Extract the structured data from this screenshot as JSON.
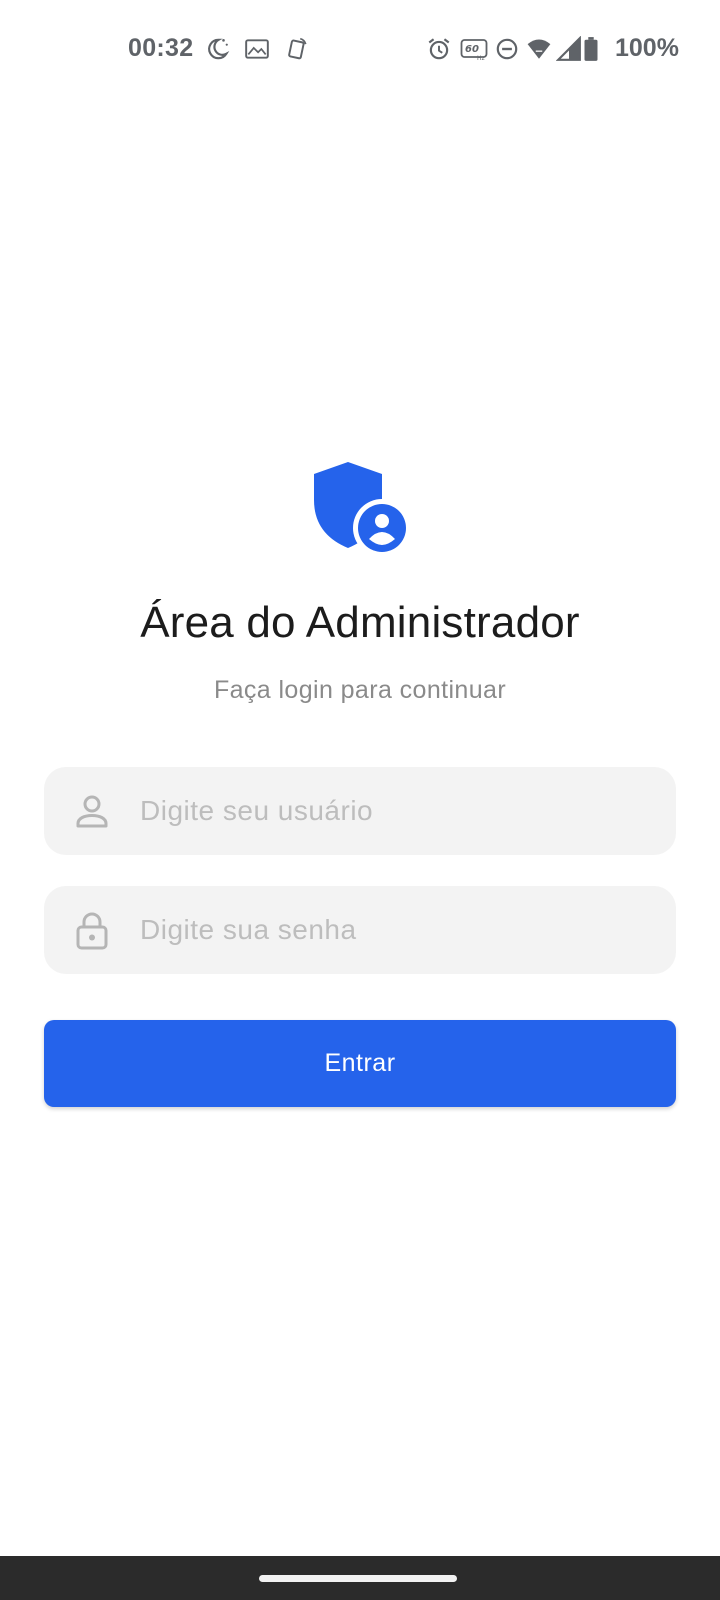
{
  "status_bar": {
    "time": "00:32",
    "battery": "100%",
    "refresh_rate": "60",
    "refresh_unit": "Hz",
    "icons": [
      "moon-icon",
      "image-icon",
      "rotate-icon",
      "alarm-icon",
      "refresh-rate-icon",
      "do-not-disturb-icon",
      "wifi-icon",
      "signal-icon",
      "battery-icon"
    ]
  },
  "login": {
    "logo_icon": "shield-user-icon",
    "title": "Área do Administrador",
    "subtitle": "Faça login para continuar",
    "username": {
      "icon": "user-icon",
      "placeholder": "Digite seu usuário",
      "value": ""
    },
    "password": {
      "icon": "lock-icon",
      "placeholder": "Digite sua senha",
      "value": ""
    },
    "submit_label": "Entrar"
  },
  "colors": {
    "accent": "#2563eb",
    "field_background": "#f3f3f3",
    "placeholder": "#bdbdbd",
    "title": "#1c1c1c",
    "subtitle": "#8a8a8a",
    "nav_bar": "#2b2b2b"
  }
}
